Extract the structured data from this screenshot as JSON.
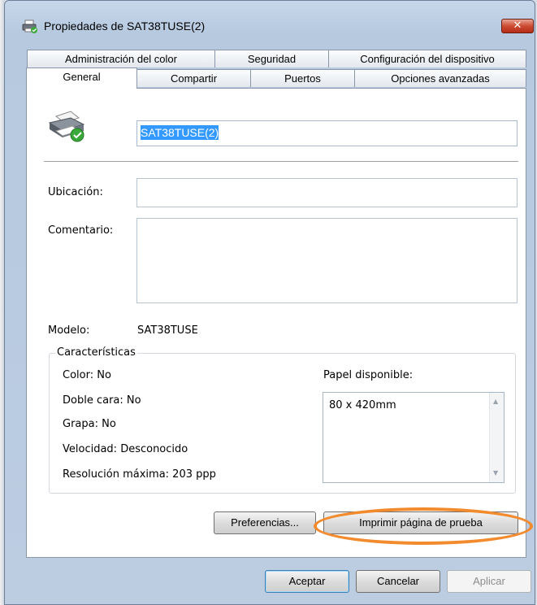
{
  "window": {
    "title": "Propiedades de SAT38TUSE(2)",
    "close_label": "✕"
  },
  "tabs_back": [
    "Administración del color",
    "Seguridad",
    "Configuración del dispositivo"
  ],
  "tabs_front": [
    "General",
    "Compartir",
    "Puertos",
    "Opciones avanzadas"
  ],
  "active_tab": "General",
  "general": {
    "printer_name": "SAT38TUSE(2)",
    "ubicacion_label": "Ubicación:",
    "ubicacion_value": "",
    "comentario_label": "Comentario:",
    "comentario_value": "",
    "modelo_label": "Modelo:",
    "modelo_value": "SAT38TUSE"
  },
  "features": {
    "title": "Características",
    "color": "Color: No",
    "doble_cara": "Doble cara: No",
    "grapa": "Grapa: No",
    "velocidad": "Velocidad: Desconocido",
    "resolucion": "Resolución máxima: 203 ppp",
    "paper_label": "Papel disponible:",
    "paper_items": [
      "80 x 420mm"
    ]
  },
  "buttons": {
    "preferencias": "Preferencias...",
    "imprimir": "Imprimir página de prueba",
    "aceptar": "Aceptar",
    "cancelar": "Cancelar",
    "aplicar": "Aplicar"
  },
  "colors": {
    "highlight": "#3399ff",
    "annotation_oval": "#f28a2e"
  },
  "icons": {
    "title": "printer-icon",
    "printer": "printer-default-icon"
  }
}
